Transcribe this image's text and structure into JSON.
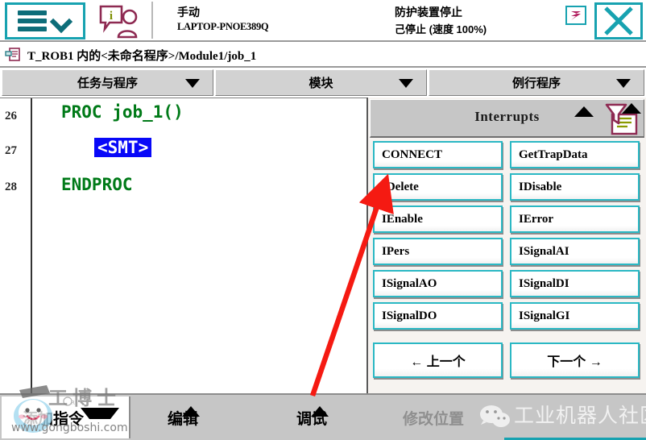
{
  "header": {
    "menu_icon": "hamburger-menu-icon",
    "menu_caret_icon": "chevron-down-icon",
    "operator_icon": "info-operator-icon",
    "mode": "手动",
    "host": "LAPTOP-PNOE389Q",
    "guard_state": "防护装置停止",
    "run_state": "己停止 (速度 100%)",
    "badge_icon": "task-status-icon",
    "close_icon": "close-icon",
    "accent_color": "#17a2b0"
  },
  "breadcrumb": {
    "icon": "program-module-icon",
    "text": "T_ROB1 内的<未命名程序>/Module1/job_1"
  },
  "tabs": [
    {
      "label": "任务与程序",
      "caret_icon": "caret-down-icon"
    },
    {
      "label": "模块",
      "caret_icon": "caret-down-icon"
    },
    {
      "label": "例行程序",
      "caret_icon": "caret-down-icon"
    }
  ],
  "editor": {
    "lines": [
      {
        "number": "26",
        "text": "PROC job_1()",
        "indent": 0,
        "selected": false
      },
      {
        "number": "27",
        "text": "<SMT>",
        "indent": 1,
        "selected": true
      },
      {
        "number": "28",
        "text": "ENDPROC",
        "indent": 0,
        "selected": false
      }
    ],
    "code_color": "#007a18",
    "selection_bg": "#0808f8"
  },
  "instruction_panel": {
    "title": "Interrupts",
    "collapse_icon": "caret-up-icon",
    "filter_icon": "filter-document-icon",
    "filter_caret_icon": "caret-up-icon",
    "buttons": [
      "CONNECT",
      "GetTrapData",
      "IDelete",
      "IDisable",
      "IEnable",
      "IError",
      "IPers",
      "ISignalAI",
      "ISignalAO",
      "ISignalDI",
      "ISignalDO",
      "ISignalGI"
    ],
    "nav": {
      "prev": "←  上一个",
      "next": "下一个 →"
    },
    "button_border_color": "#2bb8c4"
  },
  "bottom_bar": {
    "add_instruction": "添加指令",
    "add_caret_icon": "caret-down-icon",
    "items": [
      {
        "label": "编辑",
        "caret_icon": "caret-up-icon",
        "disabled": false
      },
      {
        "label": "调试",
        "caret_icon": "caret-up-icon",
        "disabled": false
      },
      {
        "label": "修改位置",
        "caret_icon": "none",
        "disabled": true
      }
    ]
  },
  "watermarks": {
    "left_brand": "工博士",
    "left_url": "www.gongboshi.com",
    "right_brand": "工业机器人社区",
    "right_icon": "wechat-icon"
  },
  "annotation": {
    "arrow_icon": "red-pointer-arrow",
    "arrow_color": "#f51a12",
    "points_to": "IDelete"
  }
}
